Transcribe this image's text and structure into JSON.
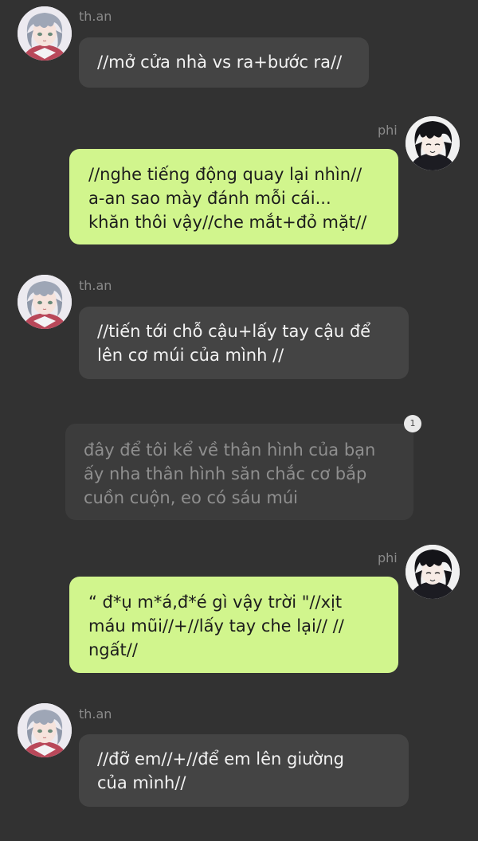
{
  "characters": {
    "than": {
      "name": "th.an",
      "avatar_icon": "silver-hair-avatar-icon"
    },
    "phi": {
      "name": "phi",
      "avatar_icon": "dark-hair-avatar-icon"
    }
  },
  "messages": [
    {
      "sender": "than",
      "side": "left",
      "lines": [
        "//mở cửa nhà vs ra+bước ra//"
      ]
    },
    {
      "sender": "phi",
      "side": "right",
      "lines": [
        "//nghe tiếng động quay lại nhìn//",
        "a-an sao mày đánh mỗi cái...",
        "khăn thôi vậy//che mắt+đỏ mặt//"
      ]
    },
    {
      "sender": "than",
      "side": "left",
      "lines": [
        "//tiến tới chỗ cậu+lấy tay cậu để",
        "lên cơ múi của mình //"
      ]
    },
    {
      "sender": "narration",
      "side": "center",
      "badge": "1",
      "lines": [
        "đây để tôi kể về thân hình của bạn",
        "ấy nha thân hình săn chắc cơ bắp",
        "cuồn cuộn, eo có sáu múi"
      ]
    },
    {
      "sender": "phi",
      "side": "right",
      "lines": [
        "“ đ*ụ m*á,đ*é gì vậy trời \"//xịt",
        "máu mũi//+//lấy tay che lại// //",
        "ngất//"
      ]
    },
    {
      "sender": "than",
      "side": "left",
      "lines": [
        "//đỡ em//+//để em lên giường",
        "của mình//"
      ]
    }
  ],
  "colors": {
    "background": "#323232",
    "left_bubble": "#444444",
    "right_bubble": "#d1f58d",
    "narration_bubble": "#3c3c3c",
    "narration_text": "#8f8f8f"
  }
}
